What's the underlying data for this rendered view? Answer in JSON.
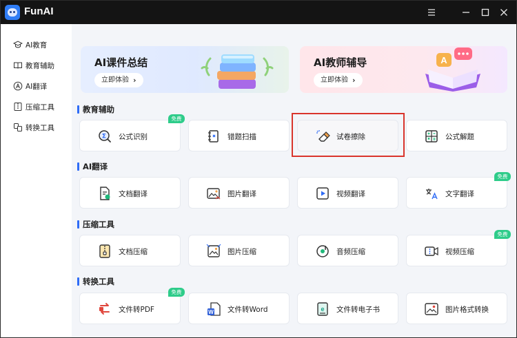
{
  "app": {
    "title": "FunAI"
  },
  "sidebar": {
    "items": [
      {
        "label": "AI教育",
        "icon": "graduation-cap-icon"
      },
      {
        "label": "教育辅助",
        "icon": "book-icon"
      },
      {
        "label": "AI翻译",
        "icon": "translate-icon"
      },
      {
        "label": "压缩工具",
        "icon": "compress-icon"
      },
      {
        "label": "转换工具",
        "icon": "convert-icon"
      }
    ]
  },
  "banners": [
    {
      "title": "AI课件总结",
      "button": "立即体验",
      "chevron": "›"
    },
    {
      "title": "AI教师辅导",
      "button": "立即体验",
      "chevron": "›",
      "bubble_letter": "A"
    }
  ],
  "badge_text": "免费",
  "sections": [
    {
      "title": "教育辅助",
      "cards": [
        {
          "label": "公式识别",
          "icon": "formula-search-icon",
          "badge": true
        },
        {
          "label": "错题扫描",
          "icon": "notebook-scan-icon",
          "badge": false
        },
        {
          "label": "试卷擦除",
          "icon": "eraser-icon",
          "badge": false,
          "highlighted": true
        },
        {
          "label": "公式解题",
          "icon": "calculator-icon",
          "badge": false
        }
      ]
    },
    {
      "title": "AI翻译",
      "cards": [
        {
          "label": "文档翻译",
          "icon": "document-translate-icon",
          "badge": false
        },
        {
          "label": "图片翻译",
          "icon": "image-translate-icon",
          "badge": false
        },
        {
          "label": "视频翻译",
          "icon": "video-translate-icon",
          "badge": false
        },
        {
          "label": "文字翻译",
          "icon": "text-translate-icon",
          "badge": true
        }
      ]
    },
    {
      "title": "压缩工具",
      "cards": [
        {
          "label": "文档压缩",
          "icon": "document-compress-icon",
          "badge": false
        },
        {
          "label": "图片压缩",
          "icon": "image-compress-icon",
          "badge": false
        },
        {
          "label": "音频压缩",
          "icon": "audio-compress-icon",
          "badge": false
        },
        {
          "label": "视频压缩",
          "icon": "video-compress-icon",
          "badge": true
        }
      ]
    },
    {
      "title": "转换工具",
      "cards": [
        {
          "label": "文件转PDF",
          "icon": "file-to-pdf-icon",
          "badge": true
        },
        {
          "label": "文件转Word",
          "icon": "file-to-word-icon",
          "badge": false
        },
        {
          "label": "文件转电子书",
          "icon": "file-to-ebook-icon",
          "badge": false
        },
        {
          "label": "图片格式转换",
          "icon": "image-format-icon",
          "badge": false
        }
      ]
    }
  ],
  "colors": {
    "accent": "#2f6cf6",
    "badge": "#2ecc8a",
    "highlight": "#d9342b",
    "titlebar": "#141414"
  }
}
